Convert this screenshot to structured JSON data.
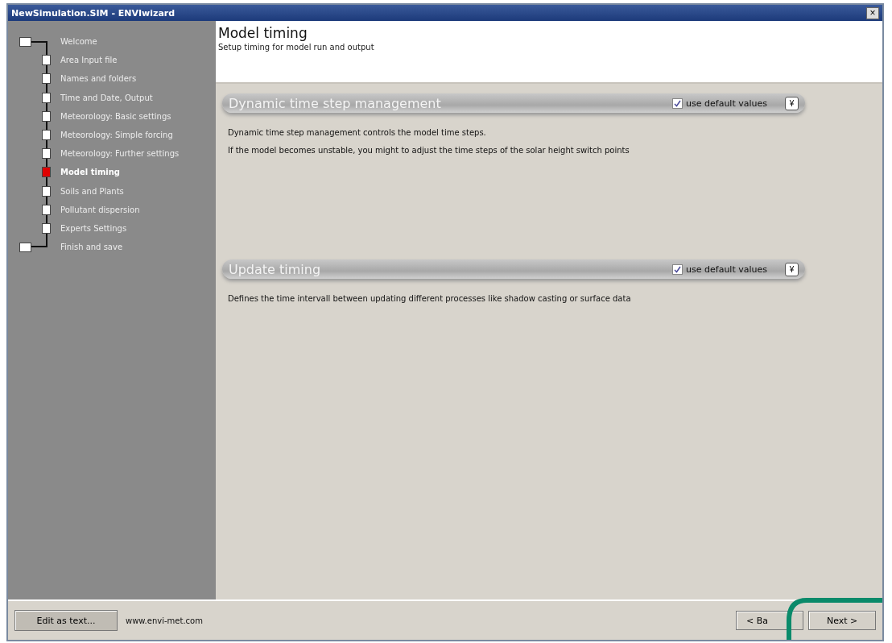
{
  "window": {
    "title": "NewSimulation.SIM - ENVIwizard",
    "close": "×"
  },
  "steps": [
    {
      "label": "Welcome",
      "kind": "terminal",
      "selected": false
    },
    {
      "label": "Area Input file",
      "kind": "step",
      "selected": false
    },
    {
      "label": "Names and folders",
      "kind": "step",
      "selected": false
    },
    {
      "label": "Time and Date, Output",
      "kind": "step",
      "selected": false
    },
    {
      "label": "Meteorology: Basic settings",
      "kind": "step",
      "selected": false
    },
    {
      "label": "Meteorology: Simple forcing",
      "kind": "step",
      "selected": false
    },
    {
      "label": "Meteorology: Further settings",
      "kind": "step",
      "selected": false
    },
    {
      "label": "Model timing",
      "kind": "step",
      "selected": true
    },
    {
      "label": "Soils and Plants",
      "kind": "step",
      "selected": false
    },
    {
      "label": "Pollutant dispersion",
      "kind": "step",
      "selected": false
    },
    {
      "label": "Experts Settings",
      "kind": "step",
      "selected": false
    },
    {
      "label": "Finish and save",
      "kind": "terminal",
      "selected": false
    }
  ],
  "header": {
    "title": "Model timing",
    "subtitle": "Setup timing for model run and output"
  },
  "panels": [
    {
      "title": "Dynamic time step management",
      "checkbox": {
        "label": "use default values",
        "checked": true
      },
      "expand": "¥",
      "lines": [
        "Dynamic time step management controls the model time steps.",
        "If the model becomes unstable, you might to adjust the time steps of the solar height switch points"
      ]
    },
    {
      "title": "Update timing",
      "checkbox": {
        "label": "use default values",
        "checked": true
      },
      "expand": "¥",
      "lines": [
        "Defines the time intervall between updating different processes like shadow casting or surface data"
      ]
    }
  ],
  "footer": {
    "edit_button": "Edit as text...",
    "website": "www.envi-met.com",
    "back_button": "< Ba",
    "next_button": "Next >"
  }
}
